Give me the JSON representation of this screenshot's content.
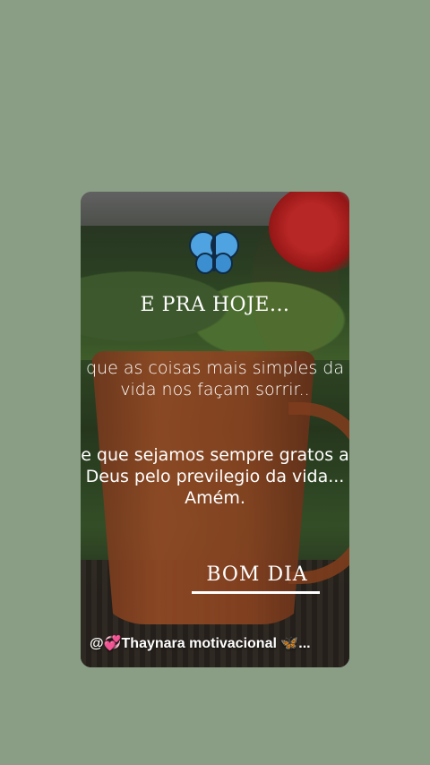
{
  "post": {
    "headline": "E PRA HOJE...",
    "message_part1": "que as coisas mais simples da vida nos façam sorrir..",
    "message_part2": "e que sejamos sempre gratos a Deus pelo previlegio da vida... Amém.",
    "signature": "BOM DIA",
    "credit": "@💞Thaynara motivacional 🦋..."
  },
  "icons": {
    "butterfly": "butterfly-icon"
  },
  "colors": {
    "background": "#8a9e86",
    "text": "#ffffff",
    "butterfly": "#4fa3e0",
    "mug": "#b35a2c"
  }
}
